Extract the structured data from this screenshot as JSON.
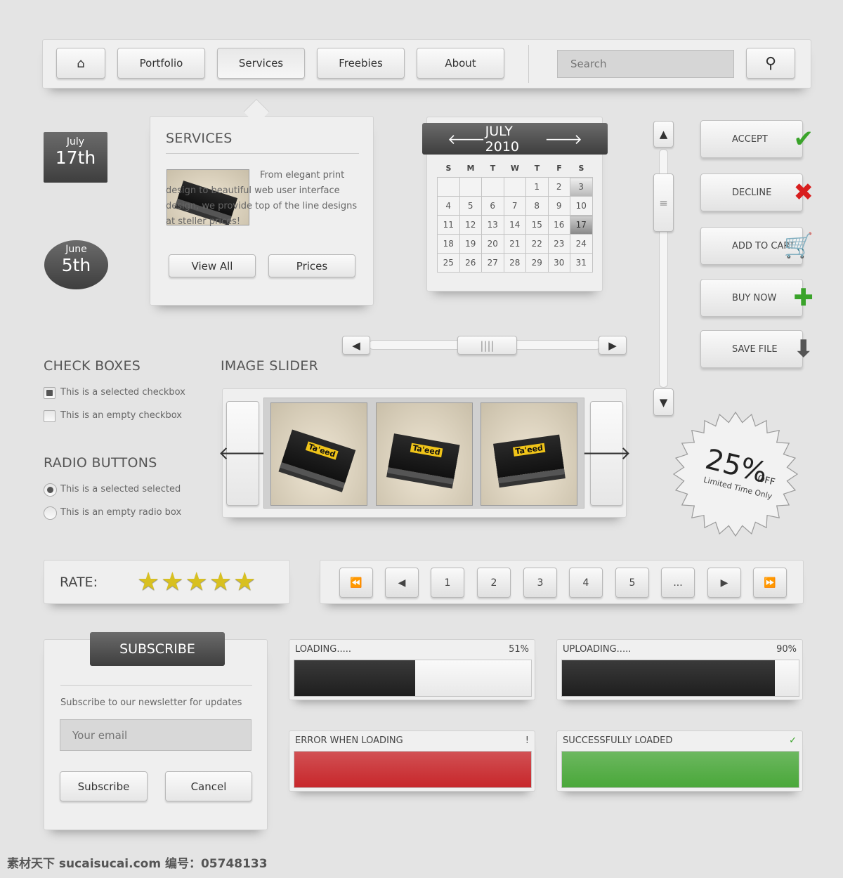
{
  "nav": {
    "items": [
      "Portfolio",
      "Services",
      "Freebies",
      "About"
    ],
    "active": "Services",
    "search_placeholder": "Search"
  },
  "dates": [
    {
      "month": "July",
      "day": "17th"
    },
    {
      "month": "June",
      "day": "5th"
    }
  ],
  "services": {
    "title": "SERVICES",
    "text": "From elegant print design to beautiful web user interface design, we provide top of the line designs at steller prices!",
    "buttons": [
      "View All",
      "Prices"
    ]
  },
  "calendar": {
    "title": "JULY 2010",
    "days_of_week": [
      "S",
      "M",
      "T",
      "W",
      "T",
      "F",
      "S"
    ],
    "weeks": [
      [
        "",
        "",
        "",
        "",
        "1",
        "2",
        "3"
      ],
      [
        "4",
        "5",
        "6",
        "7",
        "8",
        "9",
        "10"
      ],
      [
        "11",
        "12",
        "13",
        "14",
        "15",
        "16",
        "17"
      ],
      [
        "18",
        "19",
        "20",
        "21",
        "22",
        "23",
        "24"
      ],
      [
        "25",
        "26",
        "27",
        "28",
        "29",
        "30",
        "31"
      ]
    ],
    "highlighted": "3",
    "selected": "17"
  },
  "actions": [
    {
      "label": "ACCEPT",
      "icon": "check-icon",
      "color": "#3aa32a"
    },
    {
      "label": "DECLINE",
      "icon": "x-icon",
      "color": "#d81e1e"
    },
    {
      "label": "ADD TO CART",
      "icon": "cart-icon",
      "color": "#555555"
    },
    {
      "label": "BUY NOW",
      "icon": "plus-icon",
      "color": "#3aa32a"
    },
    {
      "label": "SAVE FILE",
      "icon": "download-icon",
      "color": "#555555"
    }
  ],
  "checkboxes": {
    "title": "CHECK BOXES",
    "items": [
      {
        "label": "This is a selected checkbox",
        "checked": true
      },
      {
        "label": "This is an empty checkbox",
        "checked": false
      }
    ]
  },
  "radios": {
    "title": "RADIO BUTTONS",
    "items": [
      {
        "label": "This is a selected selected",
        "checked": true
      },
      {
        "label": "This is an empty radio box",
        "checked": false
      }
    ]
  },
  "slider": {
    "title": "IMAGE SLIDER",
    "card_text": "Ta'eed"
  },
  "badge": {
    "value": "25%",
    "off": "OFF",
    "sub": "Limited Time Only"
  },
  "rate": {
    "label": "RATE:",
    "stars": 5,
    "max": 5
  },
  "pagination": {
    "pages": [
      "1",
      "2",
      "3",
      "4",
      "5",
      "..."
    ]
  },
  "subscribe": {
    "title": "SUBSCRIBE",
    "text": "Subscribe to our newsletter for updates",
    "email_placeholder": "Your email",
    "buttons": [
      "Subscribe",
      "Cancel"
    ]
  },
  "progress": [
    {
      "label": "LOADING.....",
      "percent_text": "51%",
      "value": 51
    },
    {
      "label": "UPLOADING.....",
      "percent_text": "90%",
      "value": 90
    },
    {
      "label": "ERROR WHEN LOADING",
      "percent_text": "!",
      "value": 100,
      "color": "#c8272b"
    },
    {
      "label": "SUCCESSFULLY LOADED",
      "percent_text": "✓",
      "value": 100,
      "color": "#4aa83a"
    }
  ],
  "watermark": "素材天下 sucaisucai.com  编号：05748133"
}
